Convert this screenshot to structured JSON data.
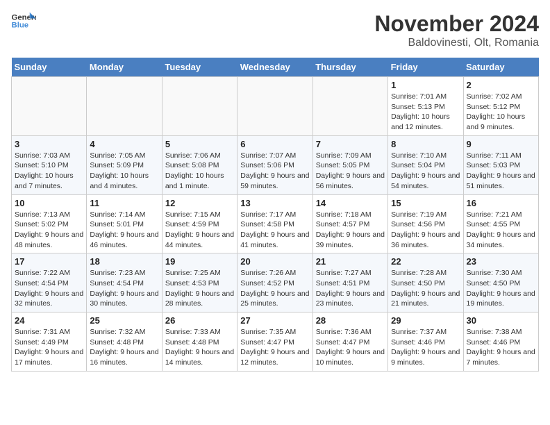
{
  "header": {
    "logo_general": "General",
    "logo_blue": "Blue",
    "month_title": "November 2024",
    "subtitle": "Baldovinesti, Olt, Romania"
  },
  "days_of_week": [
    "Sunday",
    "Monday",
    "Tuesday",
    "Wednesday",
    "Thursday",
    "Friday",
    "Saturday"
  ],
  "weeks": [
    [
      {
        "day": "",
        "info": ""
      },
      {
        "day": "",
        "info": ""
      },
      {
        "day": "",
        "info": ""
      },
      {
        "day": "",
        "info": ""
      },
      {
        "day": "",
        "info": ""
      },
      {
        "day": "1",
        "info": "Sunrise: 7:01 AM\nSunset: 5:13 PM\nDaylight: 10 hours and 12 minutes."
      },
      {
        "day": "2",
        "info": "Sunrise: 7:02 AM\nSunset: 5:12 PM\nDaylight: 10 hours and 9 minutes."
      }
    ],
    [
      {
        "day": "3",
        "info": "Sunrise: 7:03 AM\nSunset: 5:10 PM\nDaylight: 10 hours and 7 minutes."
      },
      {
        "day": "4",
        "info": "Sunrise: 7:05 AM\nSunset: 5:09 PM\nDaylight: 10 hours and 4 minutes."
      },
      {
        "day": "5",
        "info": "Sunrise: 7:06 AM\nSunset: 5:08 PM\nDaylight: 10 hours and 1 minute."
      },
      {
        "day": "6",
        "info": "Sunrise: 7:07 AM\nSunset: 5:06 PM\nDaylight: 9 hours and 59 minutes."
      },
      {
        "day": "7",
        "info": "Sunrise: 7:09 AM\nSunset: 5:05 PM\nDaylight: 9 hours and 56 minutes."
      },
      {
        "day": "8",
        "info": "Sunrise: 7:10 AM\nSunset: 5:04 PM\nDaylight: 9 hours and 54 minutes."
      },
      {
        "day": "9",
        "info": "Sunrise: 7:11 AM\nSunset: 5:03 PM\nDaylight: 9 hours and 51 minutes."
      }
    ],
    [
      {
        "day": "10",
        "info": "Sunrise: 7:13 AM\nSunset: 5:02 PM\nDaylight: 9 hours and 48 minutes."
      },
      {
        "day": "11",
        "info": "Sunrise: 7:14 AM\nSunset: 5:01 PM\nDaylight: 9 hours and 46 minutes."
      },
      {
        "day": "12",
        "info": "Sunrise: 7:15 AM\nSunset: 4:59 PM\nDaylight: 9 hours and 44 minutes."
      },
      {
        "day": "13",
        "info": "Sunrise: 7:17 AM\nSunset: 4:58 PM\nDaylight: 9 hours and 41 minutes."
      },
      {
        "day": "14",
        "info": "Sunrise: 7:18 AM\nSunset: 4:57 PM\nDaylight: 9 hours and 39 minutes."
      },
      {
        "day": "15",
        "info": "Sunrise: 7:19 AM\nSunset: 4:56 PM\nDaylight: 9 hours and 36 minutes."
      },
      {
        "day": "16",
        "info": "Sunrise: 7:21 AM\nSunset: 4:55 PM\nDaylight: 9 hours and 34 minutes."
      }
    ],
    [
      {
        "day": "17",
        "info": "Sunrise: 7:22 AM\nSunset: 4:54 PM\nDaylight: 9 hours and 32 minutes."
      },
      {
        "day": "18",
        "info": "Sunrise: 7:23 AM\nSunset: 4:54 PM\nDaylight: 9 hours and 30 minutes."
      },
      {
        "day": "19",
        "info": "Sunrise: 7:25 AM\nSunset: 4:53 PM\nDaylight: 9 hours and 28 minutes."
      },
      {
        "day": "20",
        "info": "Sunrise: 7:26 AM\nSunset: 4:52 PM\nDaylight: 9 hours and 25 minutes."
      },
      {
        "day": "21",
        "info": "Sunrise: 7:27 AM\nSunset: 4:51 PM\nDaylight: 9 hours and 23 minutes."
      },
      {
        "day": "22",
        "info": "Sunrise: 7:28 AM\nSunset: 4:50 PM\nDaylight: 9 hours and 21 minutes."
      },
      {
        "day": "23",
        "info": "Sunrise: 7:30 AM\nSunset: 4:50 PM\nDaylight: 9 hours and 19 minutes."
      }
    ],
    [
      {
        "day": "24",
        "info": "Sunrise: 7:31 AM\nSunset: 4:49 PM\nDaylight: 9 hours and 17 minutes."
      },
      {
        "day": "25",
        "info": "Sunrise: 7:32 AM\nSunset: 4:48 PM\nDaylight: 9 hours and 16 minutes."
      },
      {
        "day": "26",
        "info": "Sunrise: 7:33 AM\nSunset: 4:48 PM\nDaylight: 9 hours and 14 minutes."
      },
      {
        "day": "27",
        "info": "Sunrise: 7:35 AM\nSunset: 4:47 PM\nDaylight: 9 hours and 12 minutes."
      },
      {
        "day": "28",
        "info": "Sunrise: 7:36 AM\nSunset: 4:47 PM\nDaylight: 9 hours and 10 minutes."
      },
      {
        "day": "29",
        "info": "Sunrise: 7:37 AM\nSunset: 4:46 PM\nDaylight: 9 hours and 9 minutes."
      },
      {
        "day": "30",
        "info": "Sunrise: 7:38 AM\nSunset: 4:46 PM\nDaylight: 9 hours and 7 minutes."
      }
    ]
  ]
}
